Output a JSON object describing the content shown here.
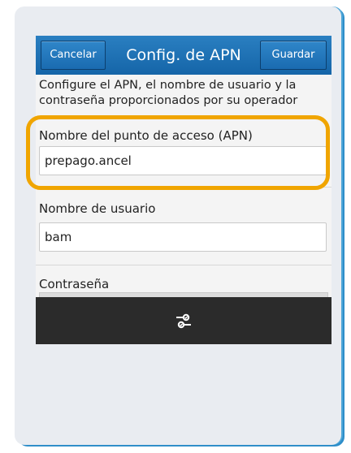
{
  "titlebar": {
    "cancel_label": "Cancelar",
    "title": "Config. de APN",
    "save_label": "Guardar"
  },
  "description": "Configure el APN, el nombre de usuario y la contraseña proporcionados por su operador",
  "fields": [
    {
      "label": "Nombre del punto de acceso (APN)",
      "value": "prepago.ancel"
    },
    {
      "label": "Nombre de usuario",
      "value": "bam"
    },
    {
      "label": "Contraseña",
      "value": ""
    }
  ],
  "bottombar": {
    "icon": "settings-sliders-icon"
  },
  "colors": {
    "accent": "#1e74b8",
    "highlight": "#f0a500",
    "bottombar": "#2b2b2b"
  }
}
